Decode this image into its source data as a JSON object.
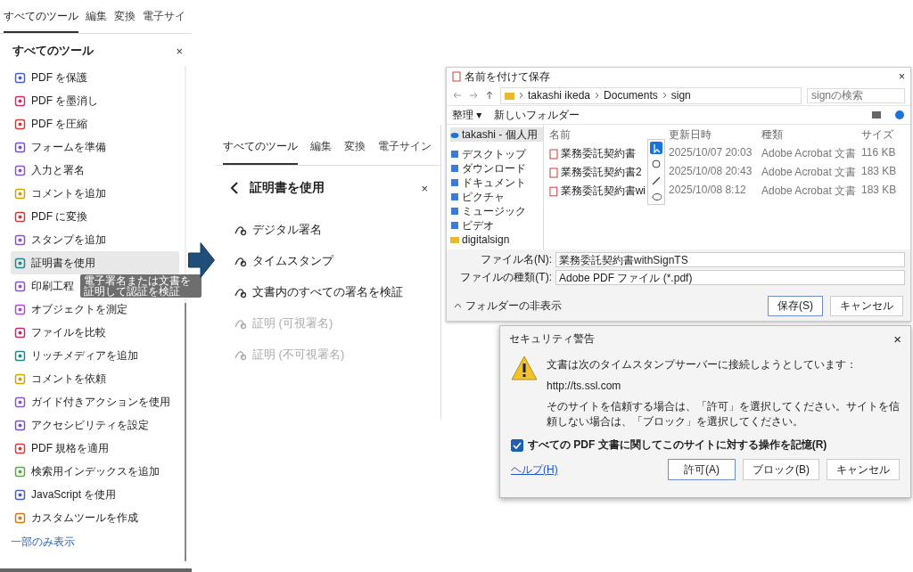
{
  "tools_panel": {
    "tabs": [
      {
        "label": "すべてのツール",
        "selected": true
      },
      {
        "label": "編集",
        "selected": false
      },
      {
        "label": "変換",
        "selected": false
      },
      {
        "label": "電子サイ",
        "selected": false
      }
    ],
    "title": "すべてのツール",
    "close": "×",
    "items": [
      {
        "label": "PDF を保護",
        "selected": false
      },
      {
        "label": "PDF を墨消し",
        "selected": false
      },
      {
        "label": "PDF を圧縮",
        "selected": false
      },
      {
        "label": "フォームを準備",
        "selected": false
      },
      {
        "label": "入力と署名",
        "selected": false
      },
      {
        "label": "コメントを追加",
        "selected": false
      },
      {
        "label": "PDF に変換",
        "selected": false
      },
      {
        "label": "スタンプを追加",
        "selected": false
      },
      {
        "label": "証明書を使用",
        "selected": true
      },
      {
        "label": "印刷工程",
        "selected": false
      },
      {
        "label": "オブジェクトを測定",
        "selected": false
      },
      {
        "label": "ファイルを比較",
        "selected": false
      },
      {
        "label": "リッチメディアを追加",
        "selected": false
      },
      {
        "label": "コメントを依頼",
        "selected": false
      },
      {
        "label": "ガイド付きアクションを使用",
        "selected": false
      },
      {
        "label": "アクセシビリティを設定",
        "selected": false
      },
      {
        "label": "PDF 規格を適用",
        "selected": false
      },
      {
        "label": "検索用インデックスを追加",
        "selected": false
      },
      {
        "label": "JavaScript を使用",
        "selected": false
      },
      {
        "label": "カスタムツールを作成",
        "selected": false
      }
    ],
    "tooltip": "電子署名または文書を証明して認証を検証",
    "show_less": "一部のみ表示"
  },
  "certificate_panel": {
    "tabs": [
      {
        "label": "すべてのツール",
        "selected": true
      },
      {
        "label": "編集",
        "selected": false
      },
      {
        "label": "変換",
        "selected": false
      },
      {
        "label": "電子サイン",
        "selected": false
      }
    ],
    "title": "証明書を使用",
    "close": "×",
    "items": [
      {
        "label": "デジタル署名",
        "disabled": false
      },
      {
        "label": "タイムスタンプ",
        "disabled": false
      },
      {
        "label": "文書内のすべての署名を検証",
        "disabled": false
      },
      {
        "label": "証明 (可視署名)",
        "disabled": true
      },
      {
        "label": "証明 (不可視署名)",
        "disabled": true
      }
    ]
  },
  "save_dialog": {
    "title": "名前を付けて保存",
    "close": "×",
    "path": [
      "takashi ikeda",
      "Documents",
      "sign"
    ],
    "search_placeholder": "signの検索",
    "toolbar": [
      "整理 ▾",
      "新しいフォルダー"
    ],
    "nav": [
      {
        "label": "takashi - 個人用",
        "kind": "cloud",
        "selected": true
      },
      {
        "label": "デスクトップ",
        "kind": "pinned",
        "selected": false
      },
      {
        "label": "ダウンロード",
        "kind": "pinned",
        "selected": false
      },
      {
        "label": "ドキュメント",
        "kind": "pinned",
        "selected": false
      },
      {
        "label": "ピクチャ",
        "kind": "pinned",
        "selected": false
      },
      {
        "label": "ミュージック",
        "kind": "pinned",
        "selected": false
      },
      {
        "label": "ビデオ",
        "kind": "pinned",
        "selected": false
      },
      {
        "label": "digitalsign",
        "kind": "folder",
        "selected": false
      }
    ],
    "columns": [
      "名前",
      "更新日時",
      "種類",
      "サイズ"
    ],
    "rows": [
      [
        "業務委託契約書",
        "2025/10/07 20:03",
        "Adobe Acrobat 文書",
        "116 KB"
      ],
      [
        "業務委託契約書2",
        "2025/10/08 20:43",
        "Adobe Acrobat 文書",
        "183 KB"
      ],
      [
        "業務委託契約書wi",
        "2025/10/08 8:12",
        "Adobe Acrobat 文書",
        "183 KB"
      ]
    ],
    "filename_label": "ファイル名(N):",
    "filename": "業務委託契約書withSignTS",
    "filetype_label": "ファイルの種類(T):",
    "filetype": "Adobe PDF ファイル (*.pdf)",
    "hide_folders": "フォルダーの非表示",
    "buttons": [
      "保存(S)",
      "キャンセル"
    ]
  },
  "security_dialog": {
    "title": "セキュリティ警告",
    "close": "×",
    "message": "文書は次のタイムスタンプサーバーに接続しようとしています：",
    "url": "http://ts.ssl.com",
    "note": "そのサイトを信頼する場合は、「許可」を選択してください。サイトを信頼しない場合は、「ブロック」を選択してください。",
    "remember": {
      "label": "すべての PDF 文書に関してこのサイトに対する操作を記憶(R)",
      "checked": true
    },
    "help": "ヘルプ(H)",
    "buttons": [
      {
        "label": "許可(A)",
        "default": true
      },
      {
        "label": "ブロック(B)",
        "default": false
      },
      {
        "label": "キャンセル",
        "default": false
      }
    ]
  }
}
